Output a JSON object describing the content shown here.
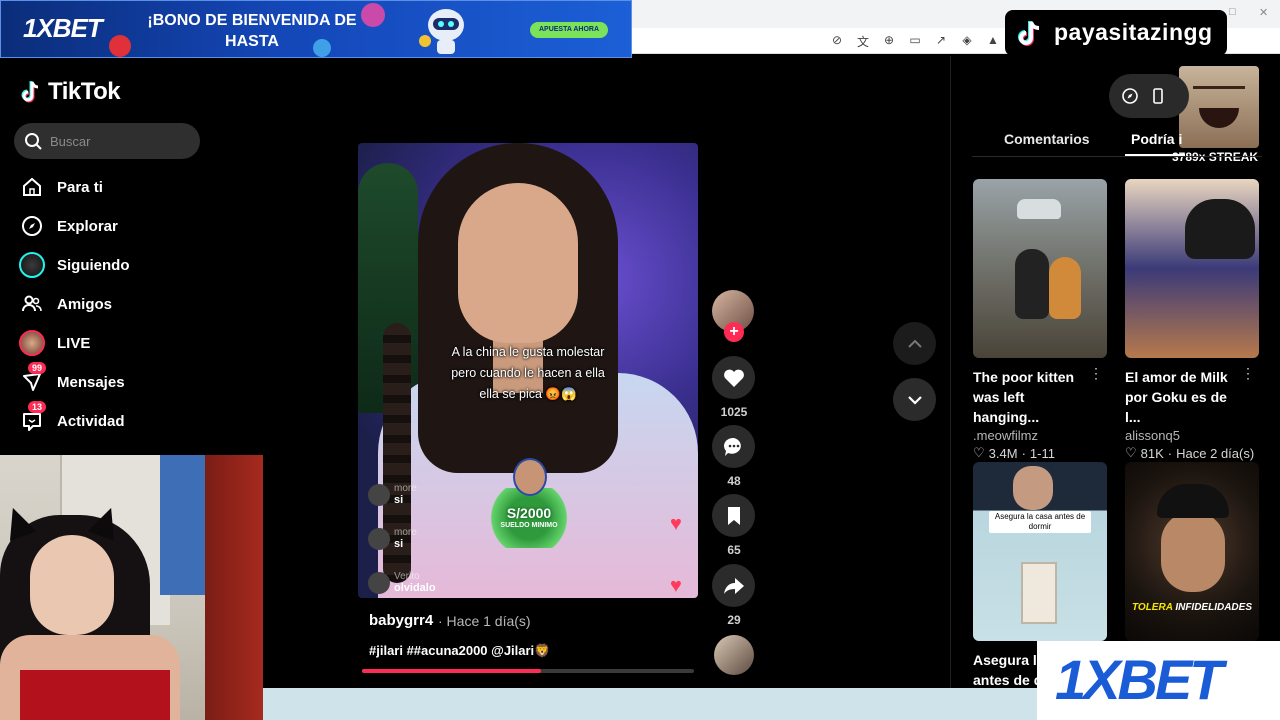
{
  "ad_banner": {
    "logo": "1XBET",
    "headline": "¡BONO DE BIENVENIDA DE HASTA",
    "cta": "APUESTA AHORA"
  },
  "overlay": {
    "channel_name": "payasitazingg",
    "streak": "3789x STREAK"
  },
  "app": {
    "brand": "TikTok"
  },
  "search": {
    "placeholder": "Buscar"
  },
  "sidebar": {
    "items": [
      {
        "label": "Para ti",
        "icon": "home-icon"
      },
      {
        "label": "Explorar",
        "icon": "compass-icon"
      },
      {
        "label": "Siguiendo",
        "icon": "following-avatar"
      },
      {
        "label": "Amigos",
        "icon": "friends-icon"
      },
      {
        "label": "LIVE",
        "icon": "live-avatar"
      },
      {
        "label": "Mensajes",
        "icon": "messages-icon",
        "badge": "99"
      },
      {
        "label": "Actividad",
        "icon": "activity-icon",
        "badge": "13"
      }
    ]
  },
  "video": {
    "caption": "A la china le gusta molestar pero cuando le hacen a ella ella se pica 😡😱",
    "sticker_amount": "S/2000",
    "sticker_sub": "SUELDO MINIMO",
    "comments": [
      {
        "user": "more",
        "text": "si"
      },
      {
        "user": "more",
        "text": "si"
      },
      {
        "user": "Verito",
        "text": "olvidalo"
      }
    ],
    "username": "babygrr4",
    "time": "· Hace 1 día(s)",
    "tags": "#jilari ##acuna2000 @Jilari🦁",
    "progress": 0.54
  },
  "actions": {
    "likes": "1025",
    "comments": "48",
    "saves": "65",
    "shares": "29"
  },
  "right_panel": {
    "tabs": [
      "Comentarios",
      "Podría i"
    ],
    "cards": [
      {
        "title": "The poor kitten was left hanging...",
        "author": ".meowfilmz",
        "likes": "3.4M",
        "date": "1-11"
      },
      {
        "title": "El amor de Milk por Goku es de l...",
        "author": "alissonq5",
        "likes": "81K",
        "date": "Hace 2 día(s)"
      },
      {
        "title": "Asegura la",
        "title2": "antes de d",
        "thumb_label": "Asegura la casa antes de dormir"
      },
      {
        "thumb_label": "TOLERA",
        "thumb_label2": "INFIDELIDADES"
      }
    ]
  },
  "corner_ad": {
    "logo": "1XBET"
  },
  "colors": {
    "accent": "#fe2c55",
    "bg": "#000000",
    "xbet_blue": "#1a5bd6"
  }
}
